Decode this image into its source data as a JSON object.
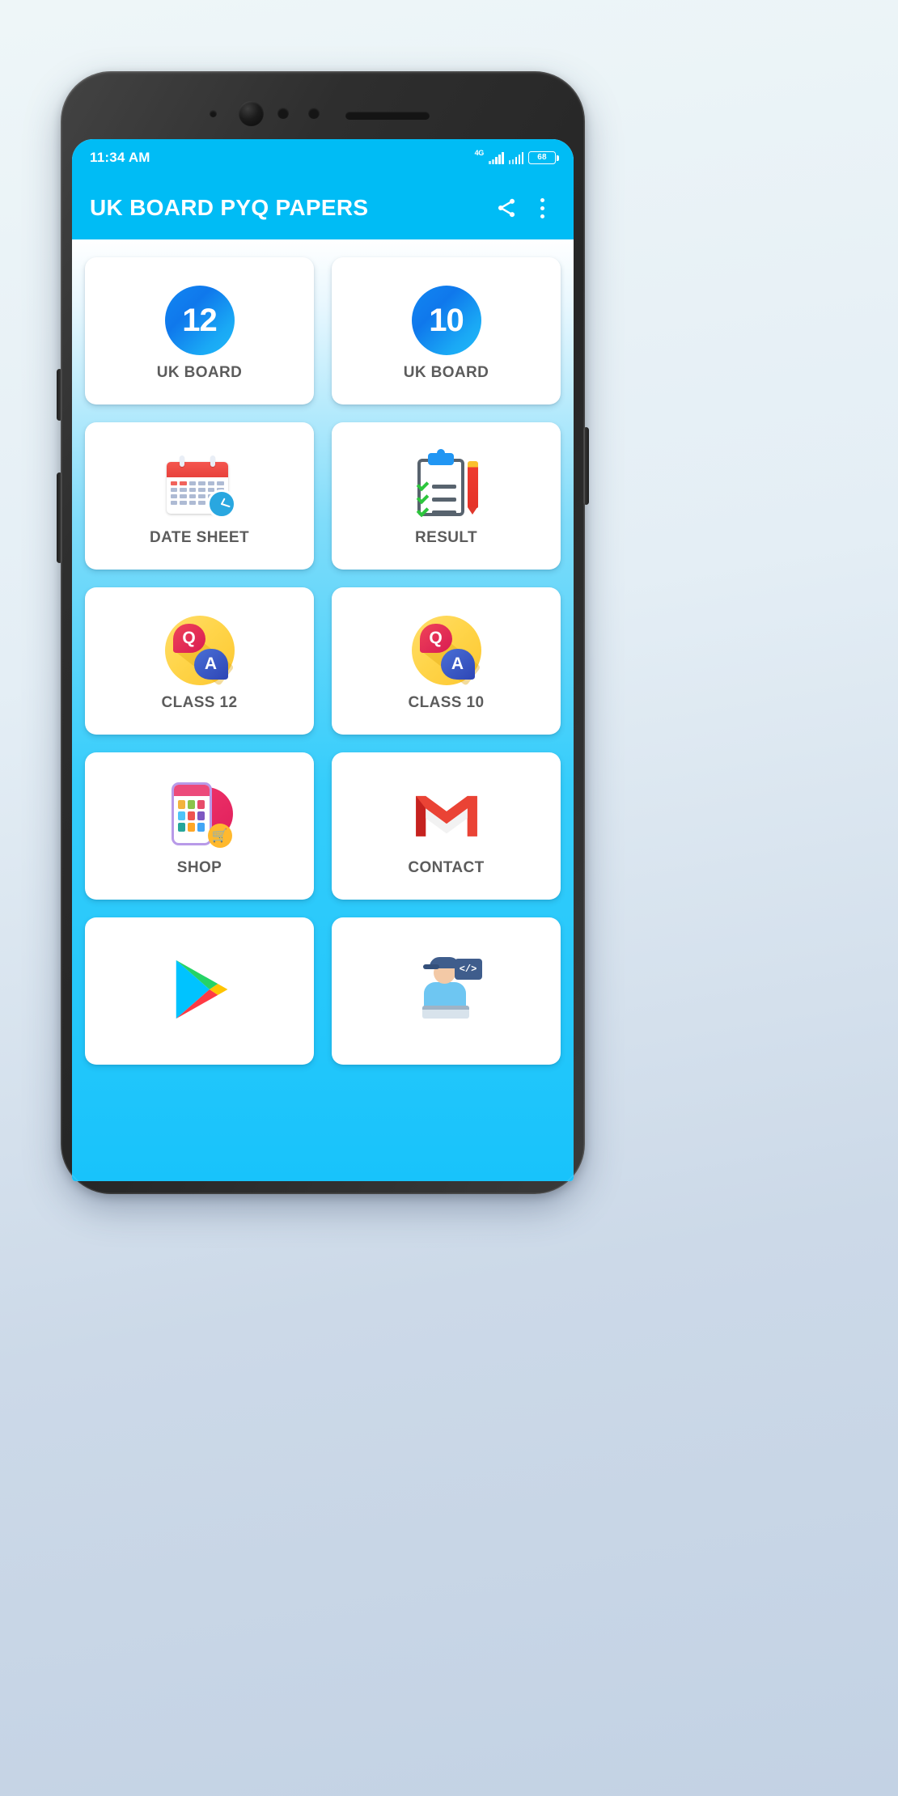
{
  "status_bar": {
    "time": "11:34 AM",
    "network_type": "4G",
    "battery_percent": "68",
    "signal_icon": "signal-bars-icon",
    "battery_icon": "battery-icon"
  },
  "app_bar": {
    "title": "UK BOARD PYQ PAPERS",
    "share_icon": "share-icon",
    "overflow_icon": "more-vertical-icon",
    "accent_color": "#00BCF5"
  },
  "grid": {
    "cards": [
      {
        "label": "UK BOARD",
        "icon": "class-12-badge-icon",
        "badge": "12"
      },
      {
        "label": "UK BOARD",
        "icon": "class-10-badge-icon",
        "badge": "10"
      },
      {
        "label": "DATE SHEET",
        "icon": "calendar-clock-icon"
      },
      {
        "label": "RESULT",
        "icon": "clipboard-checklist-icon"
      },
      {
        "label": "CLASS 12",
        "icon": "question-answer-icon"
      },
      {
        "label": "CLASS 10",
        "icon": "question-answer-icon"
      },
      {
        "label": "SHOP",
        "icon": "mobile-shop-cart-icon"
      },
      {
        "label": "CONTACT",
        "icon": "gmail-envelope-icon"
      },
      {
        "label": "",
        "icon": "google-play-icon"
      },
      {
        "label": "",
        "icon": "developer-person-icon"
      }
    ]
  },
  "qa_icon": {
    "question_letter": "Q",
    "answer_letter": "A"
  },
  "cart_glyph": "🛒",
  "code_glyph": "</>",
  "colors": {
    "accent": "#00BCF5",
    "card_bg": "#ffffff",
    "label_text": "#5c5c5c",
    "badge_gradient_start": "#1287f2",
    "badge_gradient_end": "#20b8f7"
  }
}
